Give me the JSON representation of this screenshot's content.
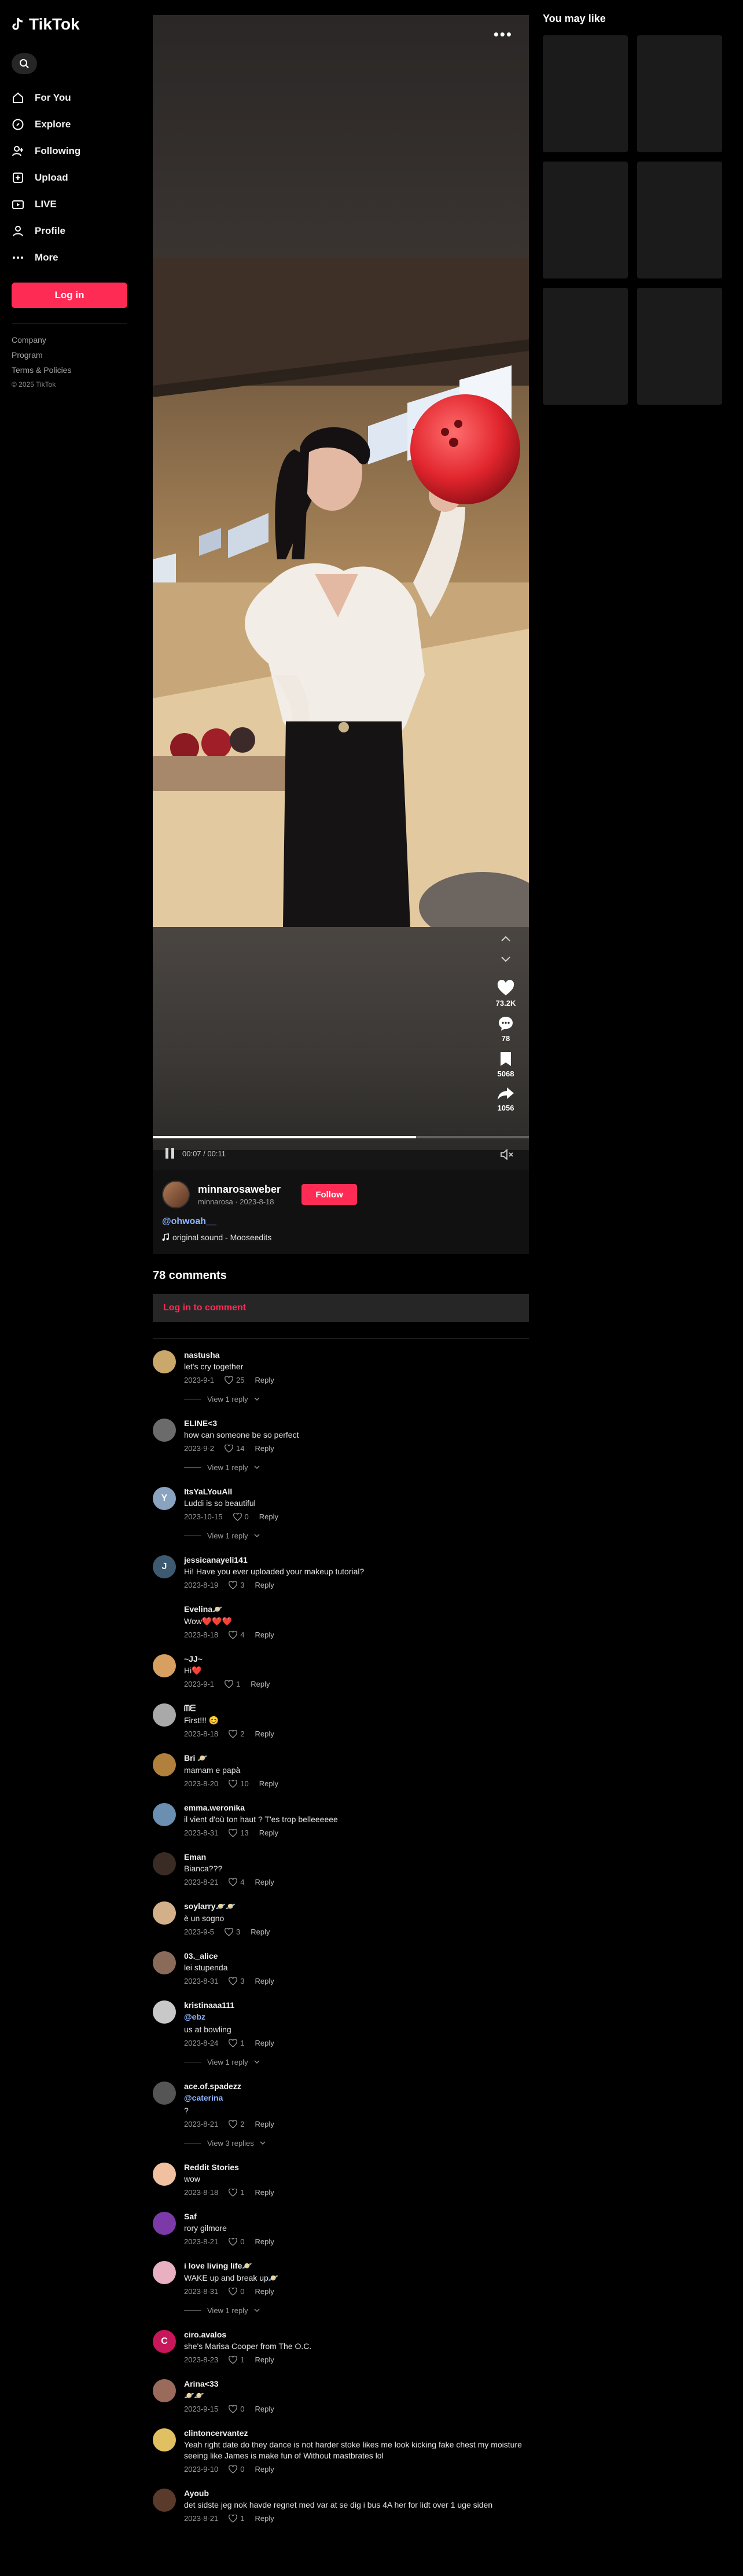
{
  "brand": {
    "name": "TikTok"
  },
  "sidebar": {
    "items": [
      {
        "label": "For You",
        "icon": "home-icon"
      },
      {
        "label": "Explore",
        "icon": "compass-icon"
      },
      {
        "label": "Following",
        "icon": "user-plus-icon"
      },
      {
        "label": "Upload",
        "icon": "upload-icon"
      },
      {
        "label": "LIVE",
        "icon": "live-icon"
      },
      {
        "label": "Profile",
        "icon": "profile-icon"
      },
      {
        "label": "More",
        "icon": "more-icon"
      }
    ],
    "login_label": "Log in",
    "footer": {
      "company": "Company",
      "program": "Program",
      "terms": "Terms & Policies",
      "copyright": "© 2025 TikTok"
    }
  },
  "video": {
    "time": "00:07 / 00:11",
    "progress": 0.7,
    "likes": "73.2K",
    "comments": "78",
    "saves": "5068",
    "shares": "1056"
  },
  "author": {
    "name": "minnarosaweber",
    "sub": "minnarosa · 2023-8-18",
    "follow_label": "Follow",
    "mention": "@ohwoah__",
    "sound": "original sound - Mooseedits"
  },
  "rail": {
    "title": "You may like"
  },
  "comments": {
    "count_label": "78 comments",
    "login_label": "Log in to comment",
    "list": [
      {
        "name": "nastusha",
        "text": "let's cry together",
        "date": "2023-9-1",
        "likes": "25",
        "reply": "Reply",
        "view": "View 1 reply",
        "avatar": "#caa76a"
      },
      {
        "name": "ELINE<3",
        "text": "how can someone be so perfect",
        "date": "2023-9-2",
        "likes": "14",
        "reply": "Reply",
        "view": "View 1 reply",
        "avatar": "#6b6b6b"
      },
      {
        "name": "ItsYaLYouAll",
        "text": "Luddi is so beautiful",
        "date": "2023-10-15",
        "likes": "0",
        "reply": "Reply",
        "view": "View 1 reply",
        "avatar": "#8aa3c0",
        "initial": "Y"
      },
      {
        "name": "jessicanayeli141",
        "text": "Hi! Have you ever uploaded your makeup tutorial?",
        "date": "2023-8-19",
        "likes": "3",
        "reply": "Reply",
        "avatar": "#3d5a70",
        "initial": "J"
      },
      {
        "name": "Evelina🪐",
        "text": "Wow❤️❤️❤️",
        "date": "2023-8-18",
        "likes": "4",
        "reply": "Reply",
        "avatar": "#000000"
      },
      {
        "name": "~JJ~",
        "text": "Hi❤️",
        "date": "2023-9-1",
        "likes": "1",
        "reply": "Reply",
        "avatar": "#d8a060"
      },
      {
        "name": "ᗰᗴ",
        "text": "First!!! 😊",
        "date": "2023-8-18",
        "likes": "2",
        "reply": "Reply",
        "avatar": "#a9a9a9"
      },
      {
        "name": "Bri 🪐",
        "text": "mamam e papà",
        "date": "2023-8-20",
        "likes": "10",
        "reply": "Reply",
        "avatar": "#b0803c"
      },
      {
        "name": "emma.weronika",
        "text": "il vient d'où ton haut ? T'es trop belleeeeee",
        "date": "2023-8-31",
        "likes": "13",
        "reply": "Reply",
        "avatar": "#6a8fb0"
      },
      {
        "name": "Eman",
        "text": "Bianca???",
        "date": "2023-8-21",
        "likes": "4",
        "reply": "Reply",
        "avatar": "#3a2b24"
      },
      {
        "name": "soylarry🪐🪐",
        "text": "è un sogno",
        "date": "2023-9-5",
        "likes": "3",
        "reply": "Reply",
        "avatar": "#d4b08a"
      },
      {
        "name": "03._alice",
        "text": "lei stupenda",
        "date": "2023-8-31",
        "likes": "3",
        "reply": "Reply",
        "avatar": "#8a6b5a"
      },
      {
        "name": "kristinaaa111",
        "mention": "@ebz",
        "text": "us at bowling",
        "date": "2023-8-24",
        "likes": "1",
        "reply": "Reply",
        "view": "View 1 reply",
        "avatar": "#c8c8c8"
      },
      {
        "name": "ace.of.spadezz",
        "mention": "@caterina",
        "text": "?",
        "date": "2023-8-21",
        "likes": "2",
        "reply": "Reply",
        "view": "View 3 replies",
        "avatar": "#555555"
      },
      {
        "name": "Reddit Stories",
        "text": "wow",
        "date": "2023-8-18",
        "likes": "1",
        "reply": "Reply",
        "avatar": "#f0c0a0"
      },
      {
        "name": "Saf",
        "text": "rory gilmore",
        "date": "2023-8-21",
        "likes": "0",
        "reply": "Reply",
        "avatar": "#7b3aa8"
      },
      {
        "name": "i love living life🪐",
        "text": "WAKE up and break up🪐",
        "date": "2023-8-31",
        "likes": "0",
        "reply": "Reply",
        "view": "View 1 reply",
        "avatar": "#e8b0c0"
      },
      {
        "name": "ciro.avalos",
        "text": "she's Marisa Cooper from The O.C.",
        "date": "2023-8-23",
        "likes": "1",
        "reply": "Reply",
        "avatar": "#c8165a",
        "initial": "C"
      },
      {
        "name": "Arina<33",
        "text": "🪐🪐",
        "date": "2023-9-15",
        "likes": "0",
        "reply": "Reply",
        "avatar": "#9a6a5a"
      },
      {
        "name": "clintoncervantez",
        "text": "Yeah right date do they dance is not harder stoke likes me look kicking fake chest my moisture seeing like James is make fun of Without mastbrates lol",
        "date": "2023-9-10",
        "likes": "0",
        "reply": "Reply",
        "avatar": "#e0c060"
      },
      {
        "name": "Ayoub",
        "text": "det sidste jeg nok havde regnet med var at se dig i bus 4A her for lidt over 1 uge siden",
        "date": "2023-8-21",
        "likes": "1",
        "reply": "Reply",
        "avatar": "#5a3a2a"
      }
    ]
  }
}
